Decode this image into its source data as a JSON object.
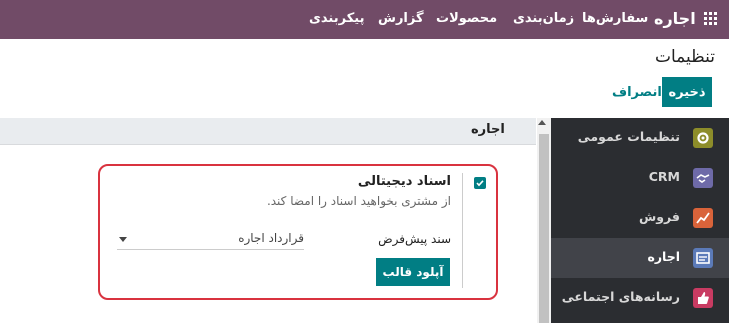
{
  "topbar": {
    "brand": "اجاره",
    "menu": [
      "سفارش‌ها",
      "زمان‌بندی",
      "محصولات",
      "گزارش",
      "پیکربندی"
    ]
  },
  "page": {
    "title": "تنظیمات"
  },
  "actions": {
    "save": "ذخیره",
    "discard": "انصراف"
  },
  "section": {
    "title": "اجاره"
  },
  "setting": {
    "label": "اسناد دیجیتالی",
    "description": "از مشتری بخواهید اسناد را امضا کند.",
    "checked": true,
    "field_label": "سند پیش‌فرض",
    "field_value": "قرارداد اجاره",
    "upload_button": "آپلود قالب"
  },
  "sidebar": {
    "items": [
      {
        "label": "تنظیمات عمومی",
        "icon": "gear-icon",
        "color": "#8d8d2a"
      },
      {
        "label": "CRM",
        "icon": "handshake-icon",
        "color": "#6e6aa8"
      },
      {
        "label": "فروش",
        "icon": "chart-icon",
        "color": "#d9633a"
      },
      {
        "label": "اجاره",
        "icon": "rental-icon",
        "color": "#5b7ab8",
        "active": true
      },
      {
        "label": "رسانه‌های اجتماعی",
        "icon": "thumbs-up-icon",
        "color": "#c93b62"
      }
    ]
  },
  "colors": {
    "brand": "#714b67",
    "accent": "#017e84",
    "highlight": "#d9333f"
  }
}
